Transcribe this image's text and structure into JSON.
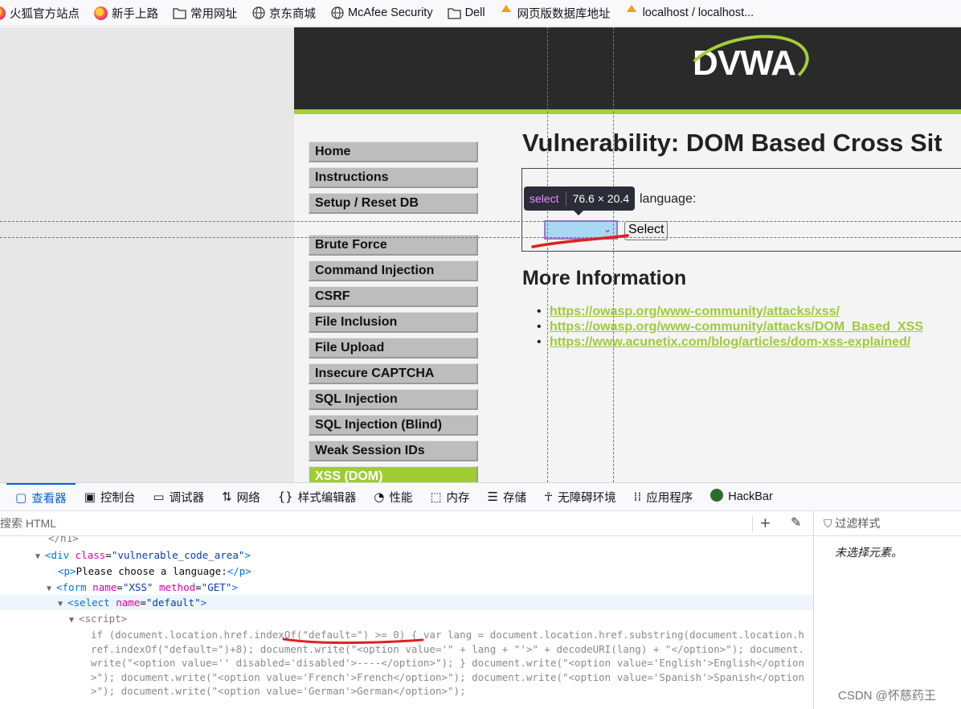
{
  "bookmarks": [
    {
      "label": "火狐官方站点",
      "icon": "firefox-icon"
    },
    {
      "label": "新手上路",
      "icon": "firefox-icon"
    },
    {
      "label": "常用网址",
      "icon": "folder-icon"
    },
    {
      "label": "京东商城",
      "icon": "globe-icon"
    },
    {
      "label": "McAfee Security",
      "icon": "globe-icon"
    },
    {
      "label": "Dell",
      "icon": "folder-icon"
    },
    {
      "label": "网页版数据库地址",
      "icon": "phpmyadmin-icon"
    },
    {
      "label": "localhost / localhost...",
      "icon": "phpmyadmin-icon"
    }
  ],
  "dvwa": {
    "logo": "DVWA",
    "menu_group1": [
      "Home",
      "Instructions",
      "Setup / Reset DB"
    ],
    "menu_group2": [
      "Brute Force",
      "Command Injection",
      "CSRF",
      "File Inclusion",
      "File Upload",
      "Insecure CAPTCHA",
      "SQL Injection",
      "SQL Injection (Blind)",
      "Weak Session IDs",
      "XSS (DOM)"
    ],
    "active_item": "XSS (DOM)",
    "title": "Vulnerability: DOM Based Cross Sit",
    "choose_text": "language:",
    "select_value": "",
    "select_button": "Select",
    "more_info_heading": "More Information",
    "links": [
      "https://owasp.org/www-community/attacks/xss/",
      "https://owasp.org/www-community/attacks/DOM_Based_XSS",
      "https://www.acunetix.com/blog/articles/dom-xss-explained/"
    ]
  },
  "inspector_tooltip": {
    "tag": "select",
    "size": "76.6 × 20.4"
  },
  "devtools": {
    "tabs": [
      {
        "label": "查看器",
        "icon": "inspector-icon",
        "active": true
      },
      {
        "label": "控制台",
        "icon": "console-icon"
      },
      {
        "label": "调试器",
        "icon": "debugger-icon"
      },
      {
        "label": "网络",
        "icon": "network-icon"
      },
      {
        "label": "样式编辑器",
        "icon": "style-editor-icon"
      },
      {
        "label": "性能",
        "icon": "performance-icon"
      },
      {
        "label": "内存",
        "icon": "memory-icon"
      },
      {
        "label": "存储",
        "icon": "storage-icon"
      },
      {
        "label": "无障碍环境",
        "icon": "accessibility-icon"
      },
      {
        "label": "应用程序",
        "icon": "application-icon"
      },
      {
        "label": "HackBar",
        "icon": "hackbar-icon"
      }
    ],
    "search_placeholder": "搜索 HTML",
    "filter_styles": "过滤样式",
    "no_element_selected": "未选择元素。",
    "watermark": "CSDN @怀慈药王",
    "html_lines": {
      "h1_close": "</h1>",
      "div_tag": "div",
      "div_attr": "class",
      "div_val": "\"vulnerable_code_area\"",
      "p_text": "Please choose a language:",
      "form_tag": "form",
      "form_attr1": "name",
      "form_val1": "\"XSS\"",
      "form_attr2": "method",
      "form_val2": "\"GET\"",
      "select_tag": "select",
      "select_attr": "name",
      "select_val": "\"default\"",
      "script_tag": "<script>",
      "script_body": "if (document.location.href.indexOf(\"default=\") >= 0) { var lang = document.location.href.substring(document.location.href.indexOf(\"default=\")+8); document.write(\"<option value='\" + lang + \"'>\" + decodeURI(lang) + \"</option>\"); document.write(\"<option value='' disabled='disabled'>----</option>\"); } document.write(\"<option value='English'>English</option>\"); document.write(\"<option value='French'>French</option>\"); document.write(\"<option value='Spanish'>Spanish</option>\"); document.write(\"<option value='German'>German</option>\");"
    }
  }
}
